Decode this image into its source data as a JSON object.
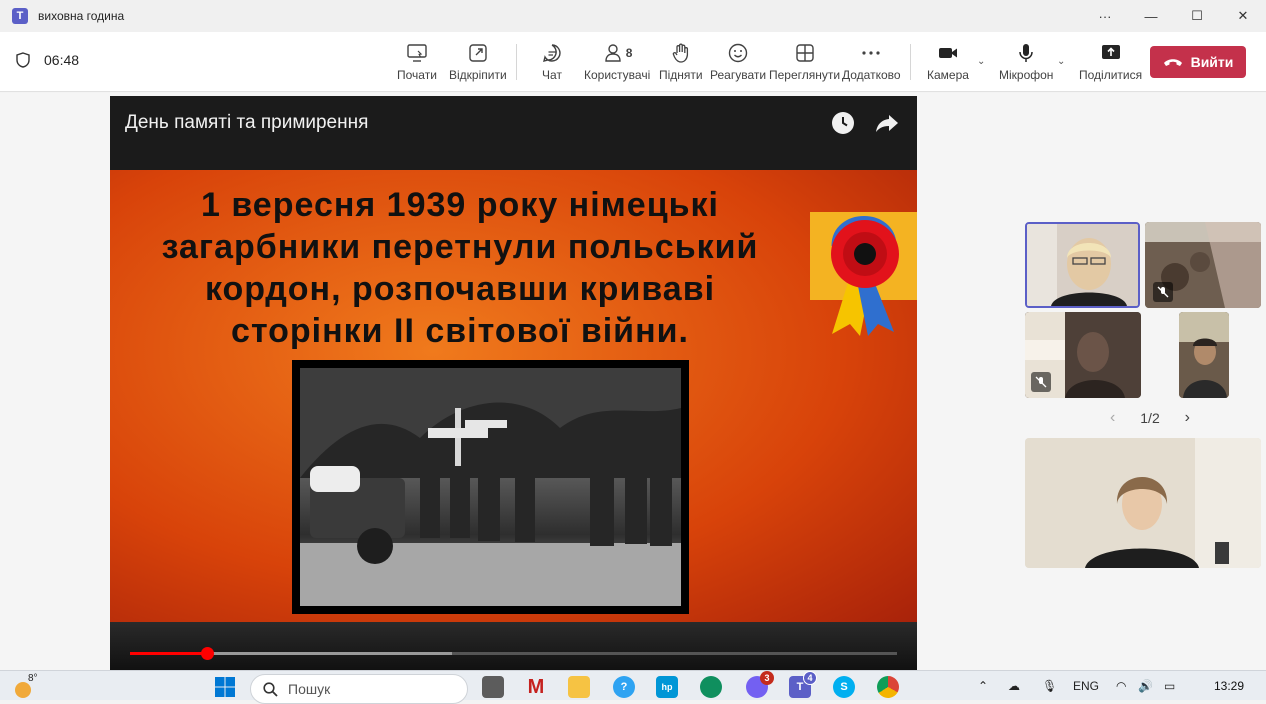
{
  "window": {
    "title": "виховна година",
    "more": "···",
    "minimize": "—",
    "maximize": "☐",
    "close": "✕"
  },
  "meeting": {
    "timer": "06:48",
    "tools": {
      "start": "Почати",
      "popout": "Відкріпити",
      "chat": "Чат",
      "people": "Користувачі",
      "people_count": "8",
      "raise": "Підняти",
      "react": "Реагувати",
      "view": "Переглянути",
      "more": "Додатково",
      "camera": "Камера",
      "mic": "Мікрофон",
      "share": "Поділитися"
    },
    "leave": "Вийти"
  },
  "video": {
    "title": "День памяті та примирення",
    "slide_lines": [
      "1 вересня 1939 року німецькі",
      "загарбники перетнули польський",
      "кордон, розпочавши криваві",
      "сторінки ІІ світової війни."
    ],
    "progress": 0.1,
    "buffered": 0.42
  },
  "gallery": {
    "page": "1/2"
  },
  "taskbar": {
    "weather": "8°",
    "search_placeholder": "Пошук",
    "viber_badge": "3",
    "teams_badge": "4",
    "lang": "ENG",
    "time": "13:29"
  },
  "colors": {
    "accent": "#5b5fc7",
    "leave": "#c4314b"
  }
}
